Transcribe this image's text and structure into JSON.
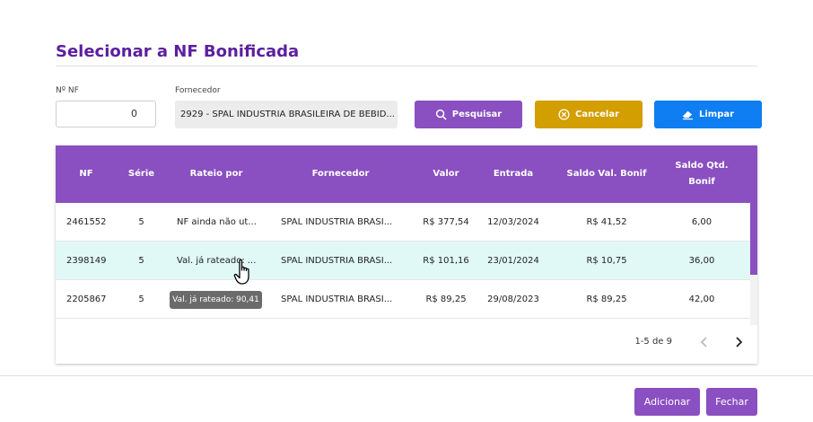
{
  "dialog": {
    "title": "Selecionar a NF Bonificada"
  },
  "filters": {
    "nf_label": "Nº NF",
    "nf_value": "0",
    "fornecedor_label": "Fornecedor",
    "fornecedor_value": "2929 - SPAL INDUSTRIA BRASILEIRA DE BEBID..."
  },
  "buttons": {
    "search": "Pesquisar",
    "cancel": "Cancelar",
    "clear": "Limpar",
    "add": "Adicionar",
    "close": "Fechar"
  },
  "table": {
    "headers": {
      "nf": "NF",
      "serie": "Série",
      "rateio": "Rateio por",
      "fornecedor": "Fornecedor",
      "valor": "Valor",
      "entrada": "Entrada",
      "saldo_val": "Saldo Val. Bonif",
      "saldo_qtd_1": "Saldo Qtd.",
      "saldo_qtd_2": "Bonif"
    },
    "rows": [
      {
        "nf": "2461552",
        "serie": "5",
        "rateio": "NF ainda não ut...",
        "fornecedor": "SPAL INDUSTRIA BRASI...",
        "valor": "R$ 377,54",
        "entrada": "12/03/2024",
        "saldo_val": "R$ 41,52",
        "saldo_qtd": "6,00"
      },
      {
        "nf": "2398149",
        "serie": "5",
        "rateio": "Val. já rateado: ...",
        "fornecedor": "SPAL INDUSTRIA BRASI...",
        "valor": "R$ 101,16",
        "entrada": "23/01/2024",
        "saldo_val": "R$ 10,75",
        "saldo_qtd": "36,00"
      },
      {
        "nf": "2205867",
        "serie": "5",
        "rateio": "",
        "fornecedor": "SPAL INDUSTRIA BRASI...",
        "valor": "R$ 89,25",
        "entrada": "29/08/2023",
        "saldo_val": "R$ 89,25",
        "saldo_qtd": "42,00"
      }
    ],
    "pagination": "1-5 de 9"
  },
  "tooltip": "Val. já rateado: 90,41",
  "colors": {
    "primary": "#8a4fc0",
    "title": "#5c1f9e",
    "cancel": "#d39e00",
    "clear": "#0f7ef2",
    "selected_row": "#e0f9f7"
  },
  "icons": {
    "search": "search-icon",
    "cancel": "cancel-circle-icon",
    "clear": "eraser-icon",
    "prev": "chevron-left-icon",
    "next": "chevron-right-icon",
    "cursor": "hand-pointer-icon"
  }
}
